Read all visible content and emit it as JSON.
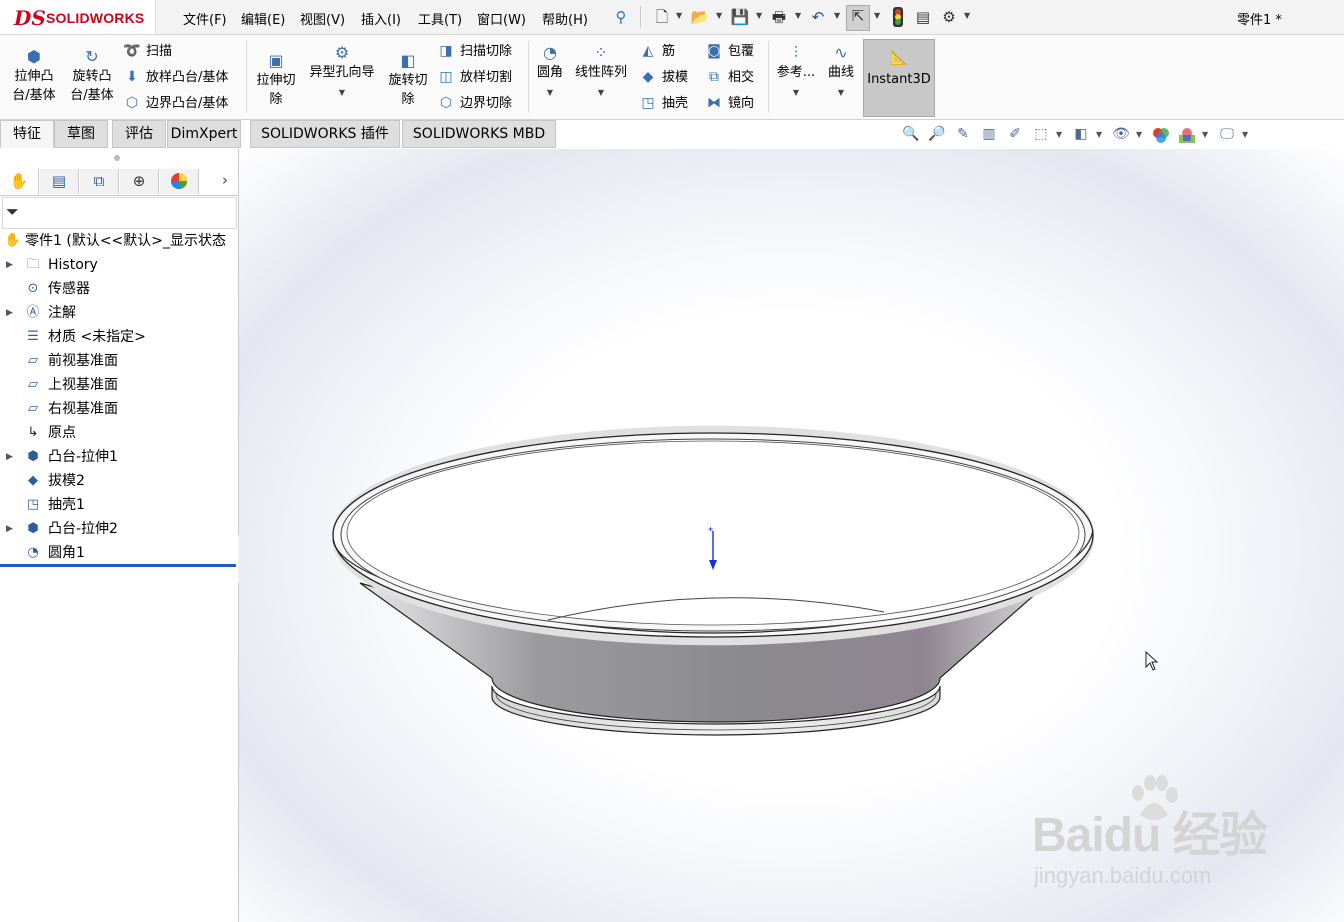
{
  "app": {
    "logo_prefix": "DS",
    "logo_text": "SOLIDWORKS",
    "doc_title": "零件1 *"
  },
  "menu": [
    "文件(F)",
    "编辑(E)",
    "视图(V)",
    "插入(I)",
    "工具(T)",
    "窗口(W)",
    "帮助(H)"
  ],
  "quick_access_icons": [
    "pin-icon",
    "new-document-icon",
    "open-icon",
    "save-icon",
    "print-icon",
    "undo-icon",
    "select-icon",
    "rebuild-traffic-light-icon",
    "file-properties-icon",
    "options-gear-icon"
  ],
  "commands": {
    "extrude_boss": "拉伸凸\n台/基体",
    "revolve_boss": "旋转凸\n台/基体",
    "sweep": "扫描",
    "loft_boss": "放样凸台/基体",
    "boundary_boss": "边界凸台/基体",
    "extrude_cut": "拉伸切\n除",
    "hole_wizard": "异型孔向导",
    "revolve_cut": "旋转切\n除",
    "sweep_cut": "扫描切除",
    "loft_cut": "放样切割",
    "boundary_cut": "边界切除",
    "fillet": "圆角",
    "linear_pattern": "线性阵列",
    "rib": "筋",
    "draft": "拔模",
    "shell": "抽壳",
    "wrap": "包覆",
    "intersect": "相交",
    "mirror": "镜向",
    "reference": "参考...",
    "curves": "曲线",
    "instant3d": "Instant3D"
  },
  "tabs": [
    "特征",
    "草图",
    "评估",
    "DimXpert",
    "SOLIDWORKS 插件",
    "SOLIDWORKS MBD"
  ],
  "active_tab": "特征",
  "heads_up_icons": [
    "zoom-to-fit-icon",
    "zoom-area-icon",
    "previous-view-icon",
    "section-view-icon",
    "dynamic-annotation-icon",
    "view-orientation-icon",
    "display-style-icon",
    "hide-show-icon",
    "edit-appearance-icon",
    "apply-scene-icon",
    "view-settings-icon"
  ],
  "panel_tabs": [
    "feature-manager-icon",
    "property-manager-icon",
    "configuration-manager-icon",
    "dimxpert-manager-icon",
    "display-manager-icon"
  ],
  "tree": {
    "root": "零件1  (默认<<默认>_显示状态",
    "items": [
      {
        "label": "History",
        "icon": "history-folder-icon",
        "expandable": true
      },
      {
        "label": "传感器",
        "icon": "sensors-icon",
        "expandable": false
      },
      {
        "label": "注解",
        "icon": "annotations-icon",
        "expandable": true
      },
      {
        "label": "材质 <未指定>",
        "icon": "material-icon",
        "expandable": false
      },
      {
        "label": "前视基准面",
        "icon": "plane-icon",
        "expandable": false
      },
      {
        "label": "上视基准面",
        "icon": "plane-icon",
        "expandable": false
      },
      {
        "label": "右视基准面",
        "icon": "plane-icon",
        "expandable": false
      },
      {
        "label": "原点",
        "icon": "origin-icon",
        "expandable": false
      },
      {
        "label": "凸台-拉伸1",
        "icon": "boss-extrude-icon",
        "expandable": true
      },
      {
        "label": "拔模2",
        "icon": "draft-icon",
        "expandable": false
      },
      {
        "label": "抽壳1",
        "icon": "shell-icon",
        "expandable": false
      },
      {
        "label": "凸台-拉伸2",
        "icon": "boss-extrude-icon",
        "expandable": true
      },
      {
        "label": "圆角1",
        "icon": "fillet-icon",
        "expandable": false
      }
    ]
  },
  "watermark": {
    "brand": "Baidu 经验",
    "site": "jingyan.baidu.com"
  },
  "colors": {
    "accent": "#1f5dbf",
    "logo_red": "#d0021b",
    "instant3d_bg": "#c8c8c8"
  }
}
